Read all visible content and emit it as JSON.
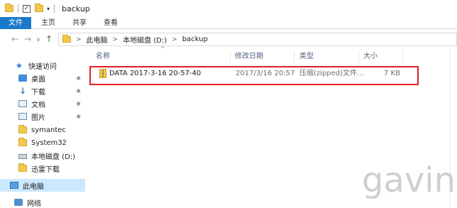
{
  "window": {
    "title": "backup",
    "qat_check": "✓",
    "qat_dropdown": "▾"
  },
  "ribbon": {
    "tabs": [
      "文件",
      "主页",
      "共享",
      "查看"
    ]
  },
  "address": {
    "back": "←",
    "forward": "→",
    "recent": "∨",
    "up": "↑",
    "separator": ">",
    "crumbs": [
      "此电脑",
      "本地磁盘 (D:)",
      "backup"
    ]
  },
  "sidebar": {
    "quick_access": "快速访问",
    "pin": "📌",
    "items": [
      {
        "label": "桌面",
        "icon": "desktop-icon",
        "pinned": true
      },
      {
        "label": "下载",
        "icon": "download-icon",
        "pinned": true
      },
      {
        "label": "文档",
        "icon": "documents-icon",
        "pinned": true
      },
      {
        "label": "图片",
        "icon": "pictures-icon",
        "pinned": true
      },
      {
        "label": "symantec",
        "icon": "folder-icon",
        "pinned": false
      },
      {
        "label": "System32",
        "icon": "folder-icon",
        "pinned": false
      },
      {
        "label": "本地磁盘 (D:)",
        "icon": "drive-icon",
        "pinned": false
      },
      {
        "label": "迅雷下载",
        "icon": "folder-icon",
        "pinned": false
      }
    ],
    "this_pc": "此电脑",
    "network": "网络"
  },
  "columns": {
    "name": "名称",
    "modified": "修改日期",
    "type": "类型",
    "size": "大小",
    "sort_indicator": "^"
  },
  "files": [
    {
      "name": "DATA 2017-3-16 20-57-40",
      "modified": "2017/3/16 20:57",
      "type": "压缩(zipped)文件...",
      "size": "7 KB",
      "icon": "zip-folder-icon"
    }
  ],
  "watermark": "gavin",
  "colors": {
    "file_tab": "#1979ca",
    "selection": "#cce8ff",
    "highlight_box": "#e02020",
    "folder": "#f3c84e"
  }
}
